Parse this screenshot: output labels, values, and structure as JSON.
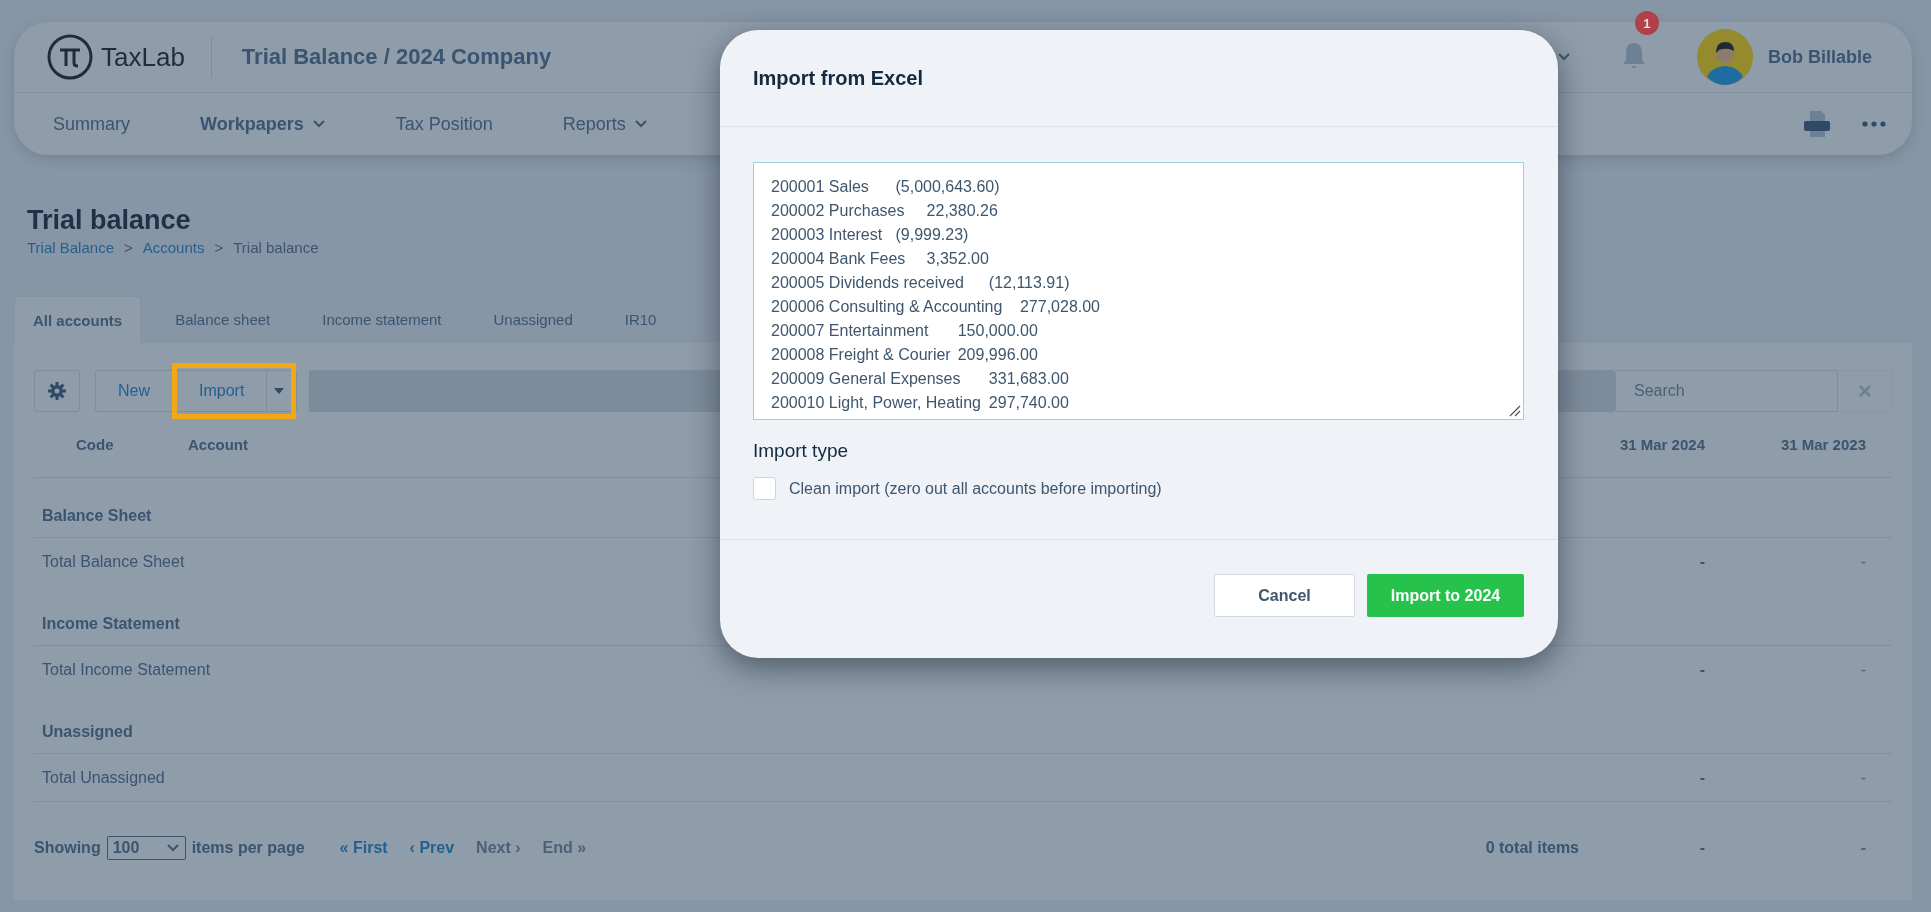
{
  "header": {
    "logo_text": "TaxLab",
    "title": "Trial Balance / 2024 Company",
    "notification_count": "1",
    "user_name": "Bob Billable"
  },
  "nav": [
    {
      "label": "Summary",
      "selected": false,
      "has_menu": false
    },
    {
      "label": "Workpapers",
      "selected": true,
      "has_menu": true
    },
    {
      "label": "Tax Position",
      "selected": false,
      "has_menu": false
    },
    {
      "label": "Reports",
      "selected": false,
      "has_menu": true
    }
  ],
  "page_title": "Trial balance",
  "breadcrumb": [
    {
      "label": "Trial Balance",
      "link": true
    },
    {
      "label": "Accounts",
      "link": true,
      "separator": ">"
    },
    {
      "label": "Trial balance",
      "link": false,
      "separator": ">"
    }
  ],
  "tabs": [
    {
      "label": "All accounts",
      "selected": true
    },
    {
      "label": "Balance sheet",
      "selected": false
    },
    {
      "label": "Income statement",
      "selected": false
    },
    {
      "label": "Unassigned",
      "selected": false
    },
    {
      "label": "IR10",
      "selected": false
    }
  ],
  "toolbar": {
    "buttons": [
      {
        "label": "New",
        "highlighted": false
      },
      {
        "label": "Import",
        "highlighted": true
      }
    ],
    "search": {
      "placeholder": "Search"
    }
  },
  "table": {
    "columns": [
      "Code",
      "Account",
      "31 Mar 2024",
      "31 Mar 2023"
    ],
    "sections": [
      {
        "heading": "Balance Sheet",
        "total_label": "Total Balance Sheet",
        "values": [
          "-",
          "-"
        ]
      },
      {
        "heading": "Income Statement",
        "total_label": "Total Income Statement",
        "values": [
          "-",
          "-"
        ]
      },
      {
        "heading": "Unassigned",
        "total_label": "Total Unassigned",
        "values": [
          "-",
          "-"
        ]
      }
    ]
  },
  "footer": {
    "showing_label": "Showing",
    "page_size": "100",
    "per_page_label": "items per page",
    "pager": [
      {
        "label": "« First",
        "disabled": false
      },
      {
        "label": "‹ Prev",
        "disabled": false
      },
      {
        "label": "Next ›",
        "disabled": true
      },
      {
        "label": "End »",
        "disabled": true
      }
    ],
    "total": "0 total items",
    "values": [
      "-",
      "-"
    ]
  },
  "dialog": {
    "title": "Import from Excel",
    "pasted_lines": [
      "200001 Sales\t(5,000,643.60)",
      "200002 Purchases\t22,380.26",
      "200003 Interest\t(9,999.23)",
      "200004 Bank Fees\t3,352.00",
      "200005 Dividends received\t(12,113.91)",
      "200006 Consulting & Accounting\t277,028.00",
      "200007 Entertainment\t150,000.00",
      "200008 Freight & Courier\t209,996.00",
      "200009 General Expenses\t331,683.00",
      "200010 Light, Power, Heating\t297,740.00"
    ],
    "section_label": "Import type",
    "checkbox": {
      "label": "Clean import (zero out all accounts before importing)",
      "checked": false
    },
    "buttons": [
      {
        "label": "Cancel",
        "kind": "secondary"
      },
      {
        "label": "Import to 2024",
        "kind": "primary"
      }
    ]
  }
}
